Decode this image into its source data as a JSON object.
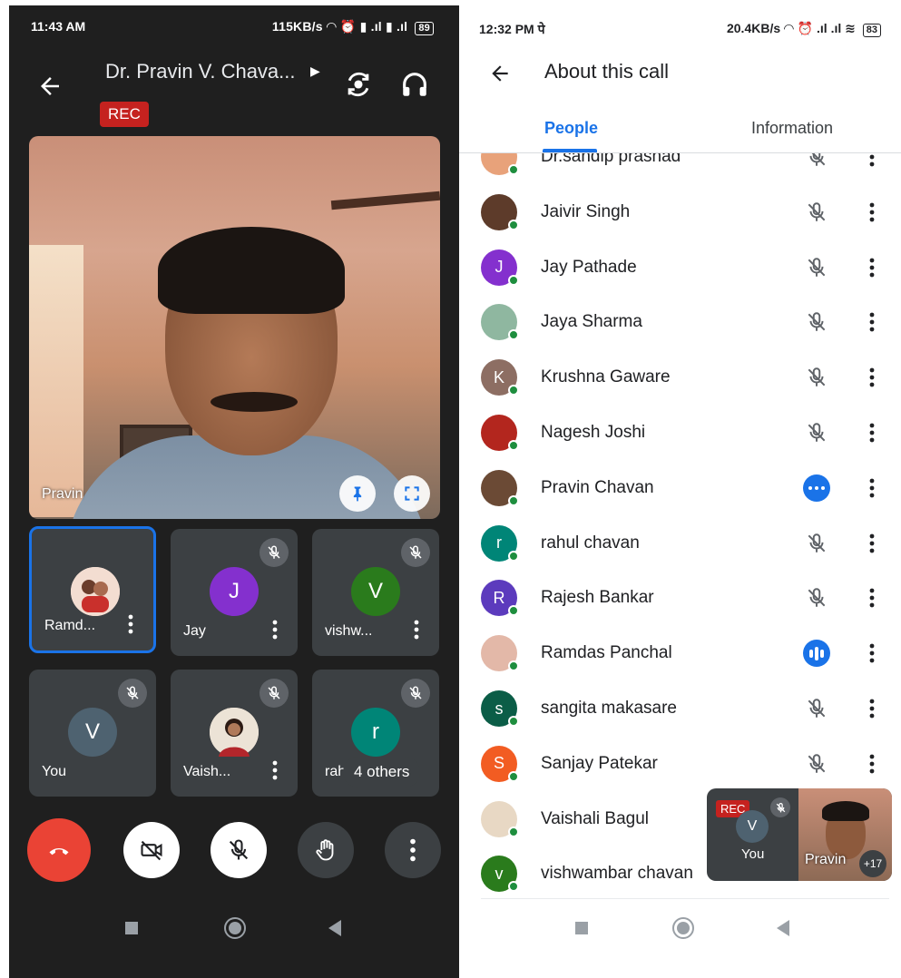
{
  "left_phone": {
    "status_bar": {
      "time": "11:43 AM",
      "right": "115KB/s",
      "battery": "89"
    },
    "call_title": "Dr. Pravin V. Chava...",
    "rec_label": "REC",
    "main_video_name": "Pravin",
    "tiles": [
      {
        "name": "Ramd...",
        "avatar_letter": "",
        "avatar_color": "#f1d9cf",
        "muted": false,
        "active": true,
        "has_menu": true
      },
      {
        "name": "Jay",
        "avatar_letter": "J",
        "avatar_color": "#8430ce",
        "muted": true,
        "active": false,
        "has_menu": true
      },
      {
        "name": "vishw...",
        "avatar_letter": "V",
        "avatar_color": "#2a7b1c",
        "muted": true,
        "active": false,
        "has_menu": true
      },
      {
        "name": "You",
        "avatar_letter": "V",
        "avatar_color": "#4e6270",
        "muted": true,
        "active": false,
        "has_menu": false
      },
      {
        "name": "Vaish...",
        "avatar_letter": "",
        "avatar_color": "#e8d8c4",
        "muted": true,
        "active": false,
        "has_menu": true
      },
      {
        "name": "rah",
        "avatar_letter": "r",
        "avatar_color": "#008577",
        "muted": true,
        "active": false,
        "has_menu": false
      }
    ],
    "others_label": "4 others",
    "colors": {
      "background": "#1f1f1f",
      "tile": "#3c4043",
      "accent": "#1a73e8",
      "end_call": "#ea4335"
    }
  },
  "right_phone": {
    "status_bar": {
      "time": "12:32 PM पे",
      "right": "20.4KB/s",
      "battery": "83"
    },
    "header_title": "About this call",
    "tabs": [
      {
        "label": "People",
        "active": true
      },
      {
        "label": "Information",
        "active": false
      }
    ],
    "participants": [
      {
        "name": "Dr.sandip prashad",
        "avatar_letter": "",
        "avatar_color": "#e8a27a",
        "status": "muted"
      },
      {
        "name": "Jaivir Singh",
        "avatar_letter": "",
        "avatar_color": "#5d3b2a",
        "status": "muted"
      },
      {
        "name": "Jay Pathade",
        "avatar_letter": "J",
        "avatar_color": "#8430ce",
        "status": "muted"
      },
      {
        "name": "Jaya Sharma",
        "avatar_letter": "",
        "avatar_color": "#8fb7a0",
        "status": "muted"
      },
      {
        "name": "Krushna Gaware",
        "avatar_letter": "K",
        "avatar_color": "#8d6e63",
        "status": "muted"
      },
      {
        "name": "Nagesh Joshi",
        "avatar_letter": "",
        "avatar_color": "#b3261e",
        "status": "muted"
      },
      {
        "name": "Pravin Chavan",
        "avatar_letter": "",
        "avatar_color": "#6b4a35",
        "status": "talking-idle"
      },
      {
        "name": "rahul chavan",
        "avatar_letter": "r",
        "avatar_color": "#008577",
        "status": "muted"
      },
      {
        "name": "Rajesh Bankar",
        "avatar_letter": "R",
        "avatar_color": "#5c3bbd",
        "status": "muted"
      },
      {
        "name": "Ramdas Panchal",
        "avatar_letter": "",
        "avatar_color": "#e3b8a8",
        "status": "speaking"
      },
      {
        "name": "sangita makasare",
        "avatar_letter": "s",
        "avatar_color": "#0b5d47",
        "status": "muted"
      },
      {
        "name": "Sanjay Patekar",
        "avatar_letter": "S",
        "avatar_color": "#f25c22",
        "status": "muted"
      },
      {
        "name": "Vaishali Bagul",
        "avatar_letter": "",
        "avatar_color": "#e8d8c4",
        "status": "none"
      },
      {
        "name": "vishwambar chavan",
        "avatar_letter": "v",
        "avatar_color": "#2a7b1c",
        "status": "none"
      }
    ],
    "pip": {
      "rec_label": "REC",
      "self_letter": "V",
      "self_label": "You",
      "other_name": "Pravin",
      "extra_count": "+17"
    },
    "colors": {
      "accent": "#1a73e8",
      "online_dot": "#1e8e3e",
      "text": "#202124"
    }
  }
}
